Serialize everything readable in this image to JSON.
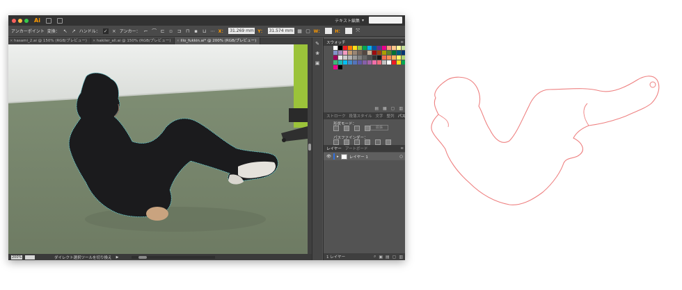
{
  "window": {
    "app_logo": "Ai",
    "workspace_label": "テキスト編集",
    "workspace_arrow": "▾",
    "traffic_colors": [
      "#fc605c",
      "#fdbc40",
      "#34c84a"
    ]
  },
  "controlbar": {
    "anchor_label": "アンカーポイント",
    "convert_label": "変換：",
    "handle_label": "ハンドル：",
    "anchor2_label": "アンカー：",
    "x_label": "X：",
    "x_value": "31.269 mm",
    "y_label": "Y：",
    "y_value": "31.574 mm",
    "w_label": "W：",
    "h_label": "H："
  },
  "doc_tabs": [
    {
      "label": "hasami_2.ai @ 150% (RGB/プレビュー)",
      "active": false
    },
    {
      "label": "hakiler_all.ai @ 150% (RGB/プレビュー)",
      "active": false
    },
    {
      "label": "illo_fukkin.ai* @ 200% (RGB/プレビュー)",
      "active": true
    }
  ],
  "statusbar": {
    "zoom": "200%",
    "status_text": "ダイレクト選択ツールを切り換え"
  },
  "panels": {
    "swatches_title": "スウォッチ",
    "mid_tabs": [
      "ストローク",
      "段落スタイル",
      "文字",
      "整列",
      "パスファインダー"
    ],
    "shape_mode_label": "形状モード：",
    "expand_label": "拡張",
    "pathfinder_label": "パスファインダー：",
    "layer_tabs": [
      "レイヤー",
      "アートボード"
    ],
    "layer_name": "レイヤー 1",
    "layers_footer_label": "1 レイヤー",
    "swatch_colors": [
      "#ffffff",
      "#000000",
      "#ed1c24",
      "#ff7f00",
      "#ffde17",
      "#8dc63f",
      "#00a651",
      "#00aeef",
      "#0054a6",
      "#662d91",
      "#ec008c",
      "#f7977a",
      "#fdc68a",
      "#fff799",
      "#c4df9b",
      "#6dcff6",
      "#8393ca",
      "#a186be",
      "#f49ac1",
      "#c69c6d",
      "#998675",
      "#736357",
      "#534741",
      "#c7b299",
      "#9e0b0f",
      "#a0410d",
      "#aba000",
      "#598527",
      "#007236",
      "#005b7f",
      "#003471",
      "#440e62",
      "#9e005d",
      "#e6e6e6",
      "#cccccc",
      "#b3b3b3",
      "#999999",
      "#808080",
      "#666666",
      "#4d4d4d",
      "#333333",
      "#1a1a1a",
      "#f26c4f",
      "#f68e56",
      "#fbaf5d",
      "#fff568",
      "#acd373",
      "#7cc576",
      "#3bb878",
      "#1abbb4",
      "#00bff3",
      "#438ccb",
      "#5574b9",
      "#605ca8",
      "#855fa8",
      "#a763a8",
      "#f06ea9",
      "#f26d7d",
      "#c2c2c2",
      "#ffffff",
      "#ed1c24",
      "#ffde17",
      "#00a651",
      "#00aeef",
      "#ec008c",
      "#000000"
    ]
  }
}
